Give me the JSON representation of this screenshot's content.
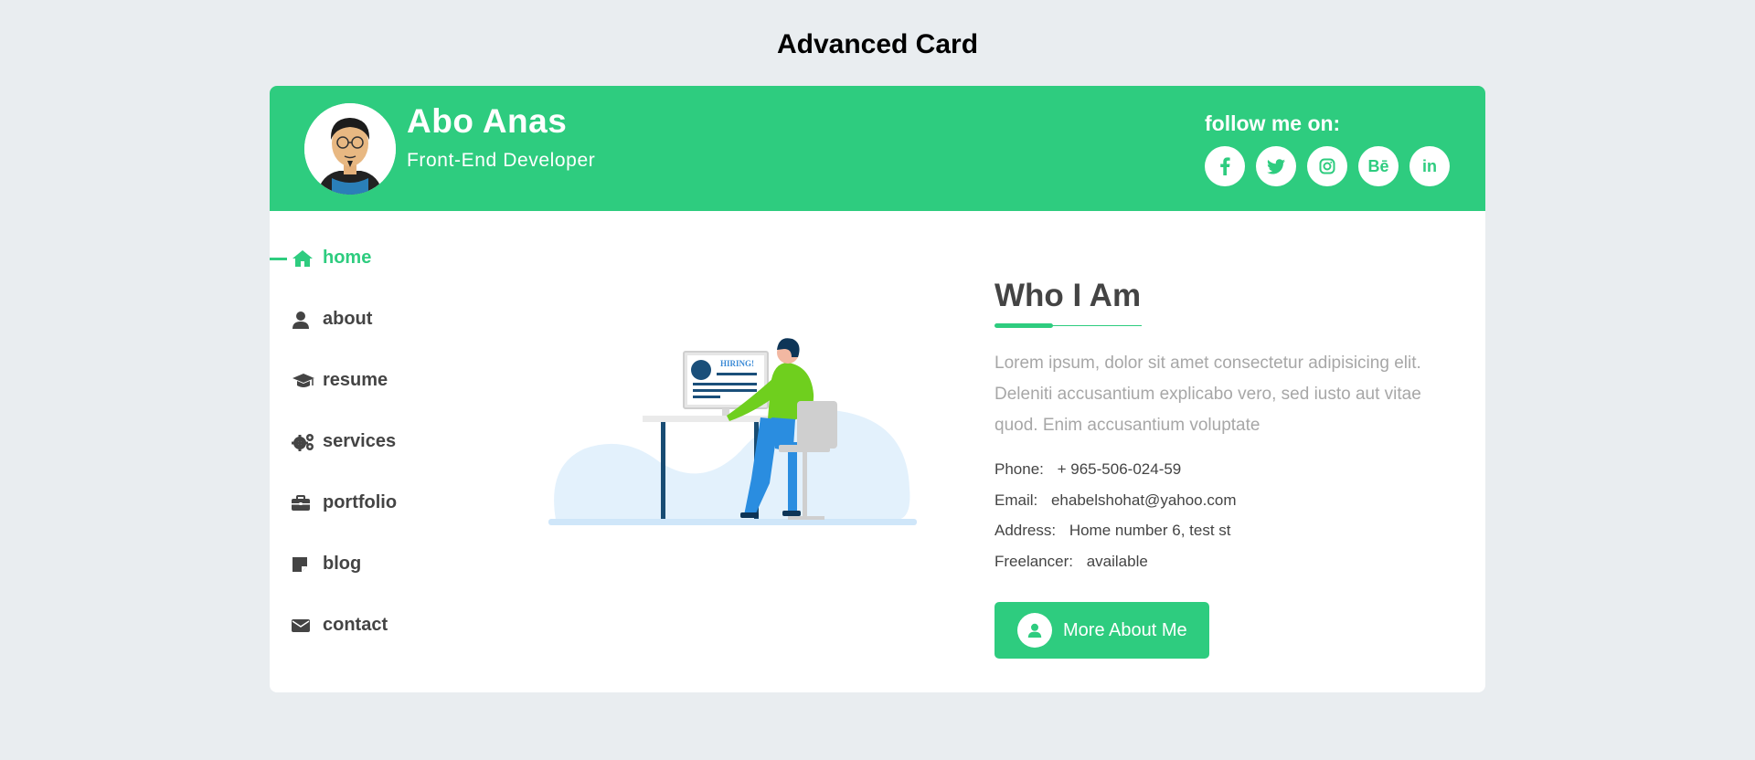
{
  "page": {
    "title": "Advanced Card"
  },
  "colors": {
    "accent": "#2ecc7f",
    "background": "#e9edf0",
    "text": "#444444",
    "muted": "#a7a7a7"
  },
  "profile": {
    "name": "Abo Anas",
    "role": "Front-End Developer"
  },
  "follow": {
    "label": "follow me on:",
    "socials": [
      {
        "name": "facebook",
        "icon": "facebook-icon"
      },
      {
        "name": "twitter",
        "icon": "twitter-icon"
      },
      {
        "name": "instagram",
        "icon": "instagram-icon"
      },
      {
        "name": "behance",
        "icon": "behance-icon",
        "glyph": "Bē"
      },
      {
        "name": "linkedin",
        "icon": "linkedin-icon",
        "glyph": "in"
      }
    ]
  },
  "nav": {
    "active": "home",
    "items": [
      {
        "label": "home",
        "icon": "home-icon"
      },
      {
        "label": "about",
        "icon": "user-icon"
      },
      {
        "label": "resume",
        "icon": "graduation-cap-icon"
      },
      {
        "label": "services",
        "icon": "gears-icon"
      },
      {
        "label": "portfolio",
        "icon": "briefcase-icon"
      },
      {
        "label": "blog",
        "icon": "note-icon"
      },
      {
        "label": "contact",
        "icon": "envelope-icon"
      }
    ]
  },
  "illustration": {
    "sign_text": "HIRING!"
  },
  "about": {
    "title": "Who I Am",
    "text": "Lorem ipsum, dolor sit amet consectetur adipisicing elit. Deleniti accusantium explicabo vero, sed iusto aut vitae quod. Enim accusantium voluptate",
    "info": [
      {
        "key": "Phone:",
        "value": "+ 965-506-024-59"
      },
      {
        "key": "Email:",
        "value": "ehabelshohat@yahoo.com"
      },
      {
        "key": "Address:",
        "value": "Home number 6, test st"
      },
      {
        "key": "Freelancer:",
        "value": "available"
      }
    ],
    "button_label": "More About Me"
  }
}
